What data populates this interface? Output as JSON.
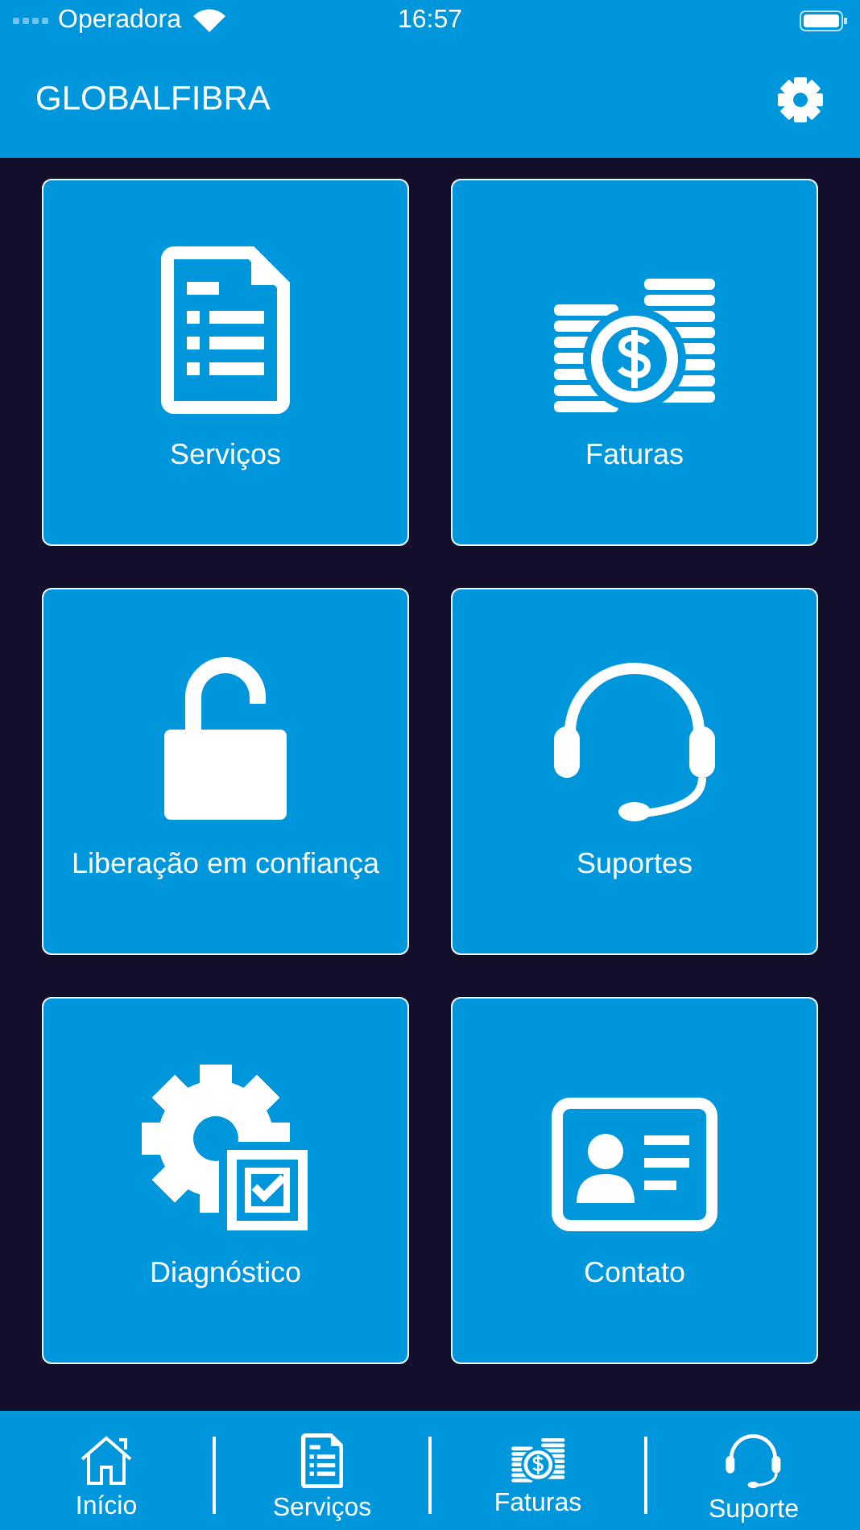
{
  "status_bar": {
    "carrier": "Operadora",
    "time": "16:57"
  },
  "nav_bar": {
    "title": "GLOBALFIBRA"
  },
  "tiles": [
    {
      "label": "Serviços"
    },
    {
      "label": "Faturas"
    },
    {
      "label": "Liberação em confiança"
    },
    {
      "label": "Suportes"
    },
    {
      "label": "Diagnóstico"
    },
    {
      "label": "Contato"
    }
  ],
  "tab_bar": [
    {
      "label": "Início"
    },
    {
      "label": "Serviços"
    },
    {
      "label": "Faturas"
    },
    {
      "label": "Suporte"
    }
  ]
}
